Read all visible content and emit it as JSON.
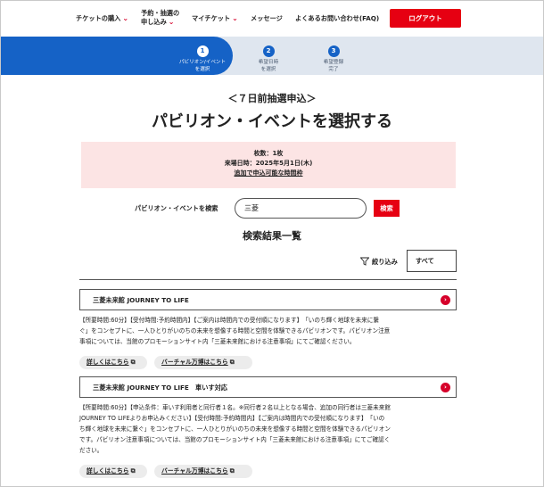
{
  "nav": {
    "items": [
      {
        "label": "チケットの購入",
        "has_chevron": true
      },
      {
        "label_line1": "予約・抽選の",
        "label_line2": "申し込み",
        "has_chevron": true
      },
      {
        "label": "マイチケット",
        "has_chevron": true
      },
      {
        "label": "メッセージ",
        "has_chevron": false
      },
      {
        "label": "よくあるお問い合わせ(FAQ)",
        "has_chevron": false
      }
    ],
    "logout_label": "ログアウト"
  },
  "steps": [
    {
      "number": "1",
      "label_line1": "パビリオン/イベント",
      "label_line2": "を選択",
      "active": true
    },
    {
      "number": "2",
      "label_line1": "希望日時",
      "label_line2": "を選択",
      "active": false
    },
    {
      "number": "3",
      "label_line1": "希望登録",
      "label_line2": "完了",
      "active": false
    }
  ],
  "page": {
    "subtitle": "＜７日前抽選申込＞",
    "title": "パビリオン・イベントを選択する"
  },
  "info": {
    "ticket_count": "枚数：1枚",
    "visit_date": "来場日時：2025年5月1日(木)",
    "link_label": "追加で申込可能な時間枠"
  },
  "search": {
    "label": "パビリオン・イベントを検索",
    "value": "三菱",
    "button_label": "検索"
  },
  "results": {
    "title": "検索結果一覧",
    "filter_label": "絞り込み",
    "filter_value": "すべて",
    "items": [
      {
        "name": "三菱未来館 JOURNEY TO LIFE",
        "desc_lines": [
          "【所要時間:60分】【受付時間:予約時間内】【ご案内は時間内での受付順になります】　「いのち輝く地球を未来に繋",
          "ぐ」をコンセプトに、一人ひとりがいのちの未来を想像する時間と空間を体験できるパビリオンです。パビリオン注意",
          "事項については、当館のプロモーションサイト内「三菱未来館における注意事項」にてご確認ください。"
        ],
        "details_label": "詳しくはこちら",
        "virtual_label": "バーチャル万博はこちら"
      },
      {
        "name": "三菱未来館 JOURNEY TO LIFE　車いす対応",
        "desc_lines": [
          "【所要時間:60分】【申込条件：車いす利用者と同行者１名。※同行者２名以上となる場合、追加の同行者は三菱未来館",
          "JOURNEY TO LIFEよりお申込みください】【受付時間:予約時間内】【ご案内は時間内での受付順になります】　「いの",
          "ち輝く地球を未来に繋ぐ」をコンセプトに、一人ひとりがいのちの未来を想像する時間と空間を体験できるパビリオン",
          "です。パビリオン注意事項については、当館のプロモーションサイト内「三菱未来館における注意事項」にてご確認く",
          "ださい。"
        ],
        "details_label": "詳しくはこちら",
        "virtual_label": "バーチャル万博はこちら"
      }
    ]
  },
  "colors": {
    "accent_red": "#e60012",
    "step_blue": "#1562c6",
    "info_bg": "#fce4e4"
  }
}
